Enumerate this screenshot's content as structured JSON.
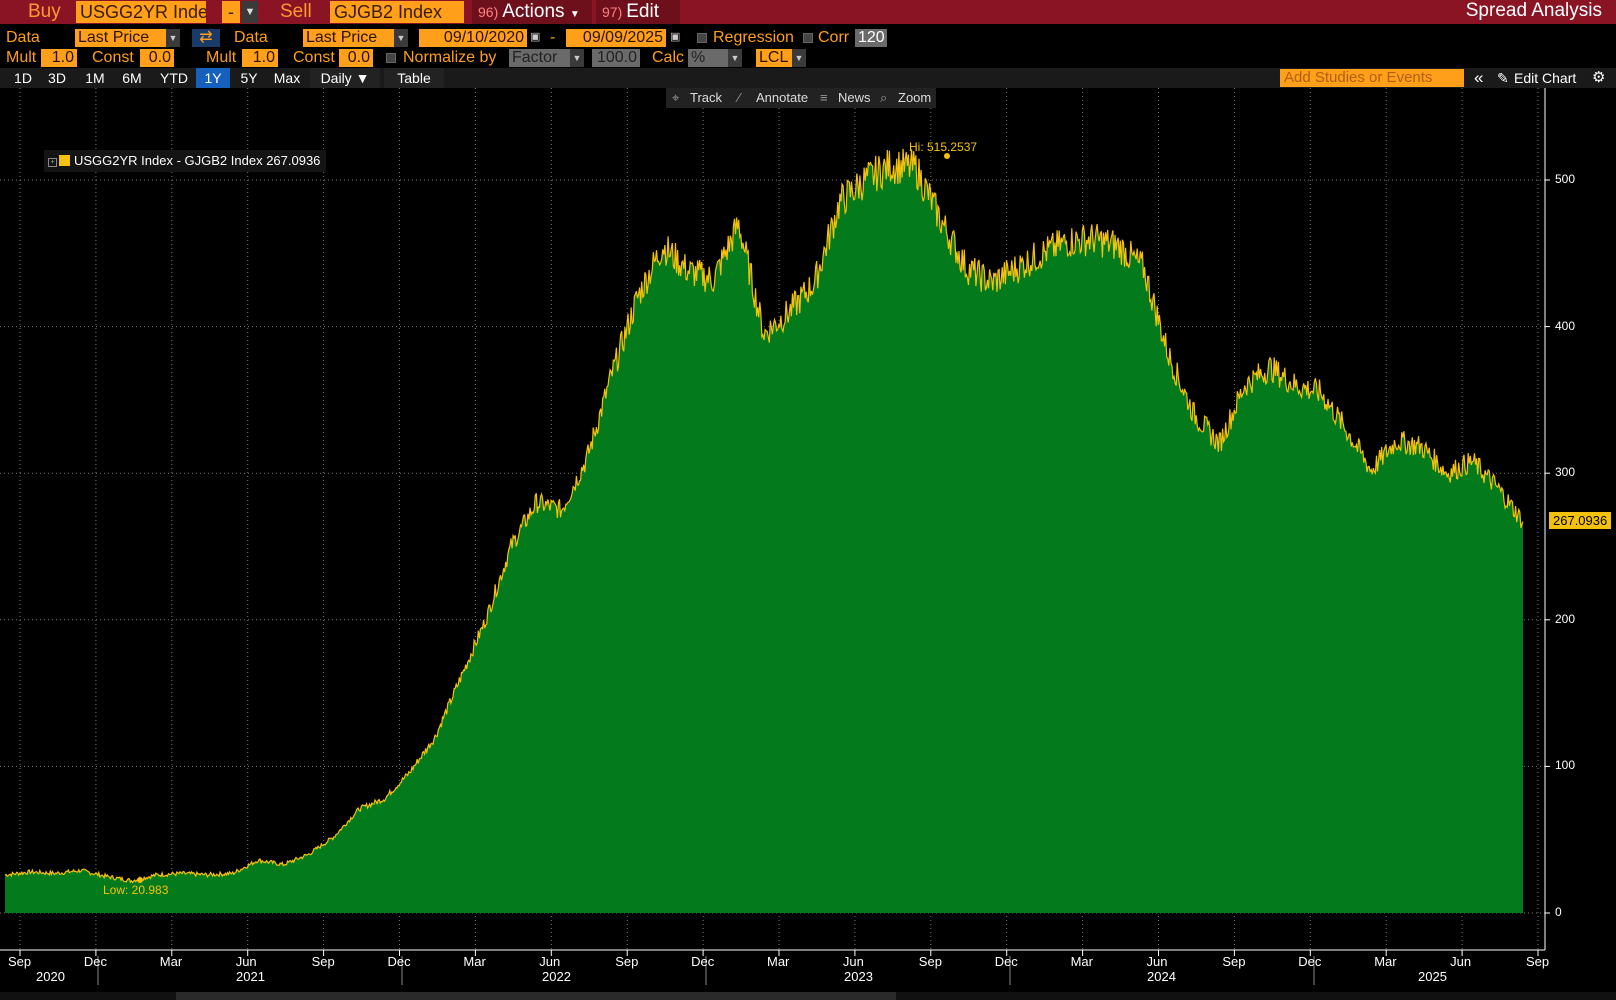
{
  "topbar": {
    "buy_label": "Buy",
    "buy_security": "USGG2YR Inde",
    "op_value": "-",
    "sell_label": "Sell",
    "sell_security": "GJGB2 Index",
    "actions_num": "96)",
    "actions_label": "Actions",
    "edit_num": "97)",
    "edit_label": "Edit",
    "title": "Spread Analysis"
  },
  "row1": {
    "data1_label": "Data",
    "data1_value": "Last Price",
    "data2_label": "Data",
    "data2_value": "Last Price",
    "start_date": "09/10/2020",
    "date_sep": "-",
    "end_date": "09/09/2025",
    "regression_label": "Regression",
    "corr_label": "Corr",
    "corr_value": "120"
  },
  "row2": {
    "mult1_label": "Mult",
    "mult1_value": "1.0",
    "const1_label": "Const",
    "const1_value": "0.0",
    "mult2_label": "Mult",
    "mult2_value": "1.0",
    "const2_label": "Const",
    "const2_value": "0.0",
    "normalize_label": "Normalize by",
    "normalize_value": "Factor",
    "factor_value": "100.0",
    "calc_label": "Calc",
    "calc_value": "%",
    "currency_value": "LCL"
  },
  "periods": {
    "items": [
      "1D",
      "3D",
      "1M",
      "6M",
      "YTD",
      "1Y",
      "5Y",
      "Max"
    ],
    "active": "1Y",
    "frequency": "Daily ▼",
    "table_label": "Table",
    "add_studies_placeholder": "Add Studies or Events",
    "collapse_icon": "«",
    "edit_chart_label": "Edit Chart"
  },
  "chart_toolbar": {
    "track": "Track",
    "annotate": "Annotate",
    "news": "News",
    "zoom": "Zoom"
  },
  "colors": {
    "area_fill": "#037a1b",
    "line": "#f4c20d",
    "topbar": "#8a1424",
    "field": "#ff9f1a",
    "active_period": "#1560bd"
  },
  "chart_data": {
    "type": "area",
    "series": [
      {
        "name": "USGG2YR Index - GJGB2 Index",
        "last_value": "267.0936",
        "x": [
          "2020-09",
          "2020-10",
          "2020-11",
          "2020-12",
          "2021-01",
          "2021-02",
          "2021-03",
          "2021-04",
          "2021-05",
          "2021-06",
          "2021-07",
          "2021-08",
          "2021-09",
          "2021-10",
          "2021-11",
          "2021-12",
          "2022-01",
          "2022-02",
          "2022-03",
          "2022-04",
          "2022-05",
          "2022-06",
          "2022-07",
          "2022-08",
          "2022-09",
          "2022-10",
          "2022-11",
          "2022-12",
          "2023-01",
          "2023-02",
          "2023-03",
          "2023-04",
          "2023-05",
          "2023-06",
          "2023-07",
          "2023-08",
          "2023-09",
          "2023-10",
          "2023-11",
          "2023-12",
          "2024-01",
          "2024-02",
          "2024-03",
          "2024-04",
          "2024-05",
          "2024-06",
          "2024-07",
          "2024-08",
          "2024-09",
          "2024-10",
          "2024-11",
          "2024-12",
          "2025-01",
          "2025-02",
          "2025-03",
          "2025-04",
          "2025-05",
          "2025-06",
          "2025-07",
          "2025-08",
          "2025-09"
        ],
        "values": [
          26,
          28,
          27,
          29,
          25,
          22,
          26,
          27,
          26,
          27,
          36,
          33,
          40,
          52,
          71,
          78,
          96,
          120,
          160,
          200,
          250,
          280,
          275,
          310,
          368,
          420,
          455,
          438,
          432,
          470,
          395,
          410,
          430,
          485,
          500,
          510,
          508,
          472,
          440,
          430,
          440,
          450,
          458,
          460,
          455,
          440,
          380,
          340,
          320,
          360,
          372,
          360,
          355,
          330,
          302,
          322,
          318,
          300,
          308,
          290,
          267
        ]
      }
    ],
    "y_ticks": [
      "500",
      "400",
      "300",
      "200",
      "100",
      "0"
    ],
    "ylim": [
      -25,
      560
    ],
    "x_month_labels": [
      "Sep",
      "Dec",
      "Mar",
      "Jun",
      "Sep",
      "Dec",
      "Mar",
      "Jun",
      "Sep",
      "Dec",
      "Mar",
      "Jun",
      "Sep",
      "Dec",
      "Mar",
      "Jun",
      "Sep",
      "Dec",
      "Mar",
      "Jun",
      "Sep"
    ],
    "x_year_labels": [
      "2020",
      "2021",
      "2022",
      "2023",
      "2024",
      "2025"
    ],
    "annotations": {
      "high": "Hi: 515.2537",
      "low": "Low: 20.983"
    },
    "legend_label": "USGG2YR Index - GJGB2 Index 267.0936",
    "last_label": "267.0936",
    "grid": true,
    "legend_position": "top-left"
  }
}
